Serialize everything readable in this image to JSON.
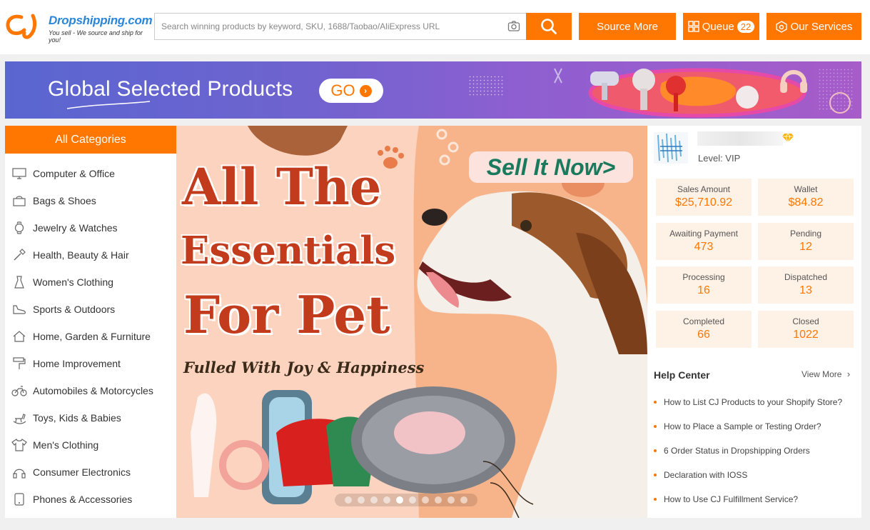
{
  "header": {
    "brand": "Dropshipping.com",
    "slogan": "You sell - We source and ship for you!",
    "search_placeholder": "Search winning products by keyword, SKU, 1688/Taobao/AliExpress URL",
    "source_more": "Source More",
    "queue_label": "Queue",
    "queue_count": "22",
    "our_services": "Our Services"
  },
  "strip": {
    "title": "Global Selected Products",
    "go_label": "GO"
  },
  "categories": {
    "header": "All Categories",
    "items": [
      {
        "label": "Computer & Office",
        "icon": "monitor-icon"
      },
      {
        "label": "Bags & Shoes",
        "icon": "bag-icon"
      },
      {
        "label": "Jewelry & Watches",
        "icon": "watch-icon"
      },
      {
        "label": "Health, Beauty & Hair",
        "icon": "brush-icon"
      },
      {
        "label": "Women's Clothing",
        "icon": "dress-icon"
      },
      {
        "label": "Sports & Outdoors",
        "icon": "sneaker-icon"
      },
      {
        "label": "Home, Garden & Furniture",
        "icon": "house-icon"
      },
      {
        "label": "Home Improvement",
        "icon": "paint-roller-icon"
      },
      {
        "label": "Automobiles & Motorcycles",
        "icon": "motorcycle-icon"
      },
      {
        "label": "Toys, Kids & Babies",
        "icon": "rocking-horse-icon"
      },
      {
        "label": "Men's Clothing",
        "icon": "shirt-icon"
      },
      {
        "label": "Consumer Electronics",
        "icon": "headphones-icon"
      },
      {
        "label": "Phones & Accessories",
        "icon": "phone-icon"
      }
    ]
  },
  "hero": {
    "line1": "All The",
    "line2": "Essentials",
    "line3": "For Pet",
    "tagline": "Fulled With Joy & Happiness",
    "cta": "Sell It Now>",
    "slide_count": 10,
    "active_slide": 5
  },
  "account": {
    "level": "Level: VIP",
    "stats": [
      {
        "label": "Sales Amount",
        "value": "$25,710.92"
      },
      {
        "label": "Wallet",
        "value": "$84.82"
      },
      {
        "label": "Awaiting Payment",
        "value": "473"
      },
      {
        "label": "Pending",
        "value": "12"
      },
      {
        "label": "Processing",
        "value": "16"
      },
      {
        "label": "Dispatched",
        "value": "13"
      },
      {
        "label": "Completed",
        "value": "66"
      },
      {
        "label": "Closed",
        "value": "1022"
      }
    ]
  },
  "help": {
    "title": "Help Center",
    "view_more": "View More",
    "items": [
      "How to List CJ Products to your Shopify Store?",
      "How to Place a Sample or Testing Order?",
      "6 Order Status in Dropshipping Orders",
      "Declaration with IOSS",
      "How to Use CJ Fulfillment Service?"
    ]
  },
  "colors": {
    "accent": "#ff7700",
    "brand_blue": "#2a86d9",
    "stat_bg": "#fef1e6"
  }
}
